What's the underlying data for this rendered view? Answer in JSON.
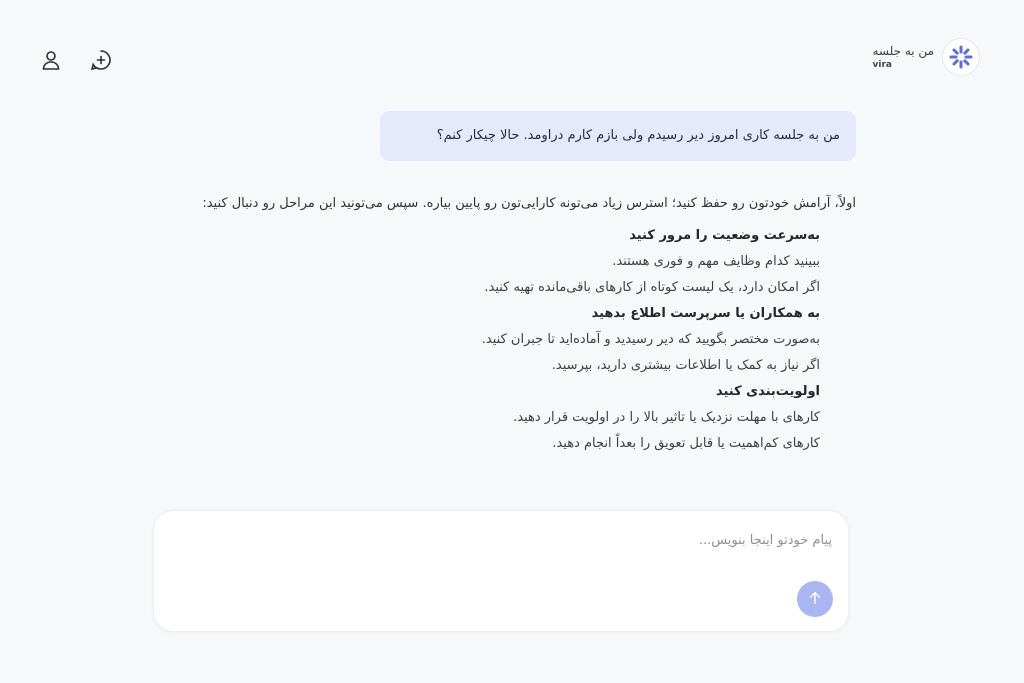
{
  "header": {
    "brand_title": "من به جلسه",
    "brand_sub": "vira"
  },
  "icons": {
    "new_chat": "chat-plus-icon",
    "profile": "user-icon",
    "logo": "vira-logo-icon",
    "send": "arrow-up-icon"
  },
  "colors": {
    "user_bubble": "#e4e9fb",
    "send_button": "#a9b6f3",
    "logo_accent": "#5b6ee1"
  },
  "conversation": {
    "user_message": "من به جلسه کاری امروز دیر رسیدم ولی بازم کارم دراومد. حالا چیکار کنم؟",
    "assistant_intro": "اولاً، آرامش خودتون رو حفظ کنید؛ استرس زیاد می‌تونه کارایی‌تون رو پایین بیاره. سپس می‌تونید این مراحل رو دنبال کنید:",
    "steps": [
      {
        "title": "به‌سرعت وضعیت را مرور کنید",
        "lines": [
          "ببینید کدام وظایف مهم و فوری هستند.",
          "اگر امکان دارد، یک لیست کوتاه از کارهای باقی‌مانده تهیه کنید."
        ]
      },
      {
        "title": "به همکاران یا سرپرست اطلاع بدهید",
        "lines": [
          "به‌صورت مختصر بگویید که دیر رسیدید و آماده‌اید تا جبران کنید.",
          "اگر نیاز به کمک یا اطلاعات بیشتری دارید، بپرسید."
        ]
      },
      {
        "title": "اولویت‌بندی کنید",
        "lines": [
          "کارهای با مهلت نزدیک یا تاثیر بالا را در اولویت قرار دهید.",
          "کارهای کم‌اهمیت یا قابل تعویق را بعداً انجام دهید."
        ]
      }
    ]
  },
  "composer": {
    "placeholder": "پیام خودتو اینجا بنویس..."
  }
}
